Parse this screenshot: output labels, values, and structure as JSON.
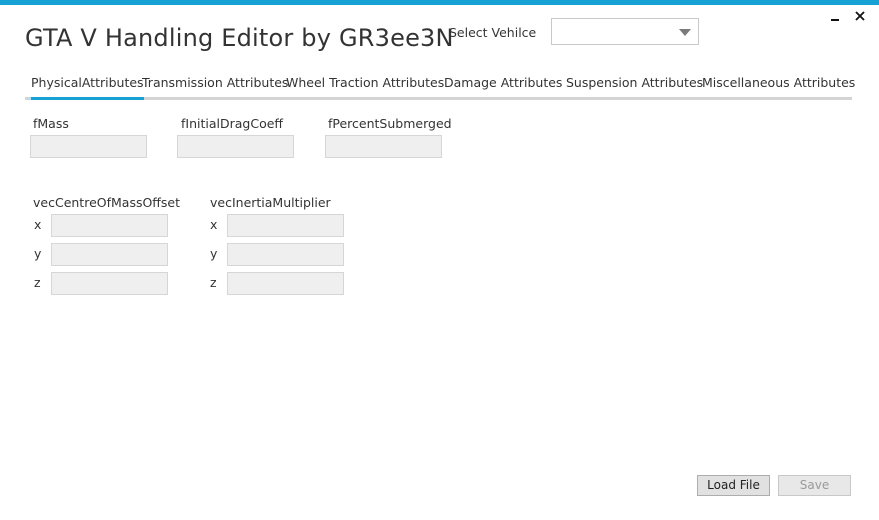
{
  "window": {
    "title": "GTA V Handling Editor by GR3ee3N",
    "minimize_glyph": "▁",
    "close_glyph": "✕"
  },
  "vehicle_select": {
    "label": "Select Vehilce",
    "value": ""
  },
  "tabs": [
    {
      "label": "PhysicalAttributes",
      "active": true
    },
    {
      "label": "Transmission Attributes",
      "active": false
    },
    {
      "label": "Wheel Traction Attributes",
      "active": false
    },
    {
      "label": "Damage Attributes",
      "active": false
    },
    {
      "label": "Suspension Attributes",
      "active": false
    },
    {
      "label": "Miscellaneous Attributes",
      "active": false
    }
  ],
  "fields": {
    "fMass": {
      "label": "fMass",
      "value": ""
    },
    "fInitialDragCoeff": {
      "label": "fInitialDragCoeff",
      "value": ""
    },
    "fPercentSubmerged": {
      "label": "fPercentSubmerged",
      "value": ""
    }
  },
  "vectors": {
    "centre_of_mass": {
      "label": "vecCentreOfMassOffset",
      "axes": [
        {
          "axis": "x",
          "value": ""
        },
        {
          "axis": "y",
          "value": ""
        },
        {
          "axis": "z",
          "value": ""
        }
      ]
    },
    "inertia": {
      "label": "vecInertiaMultiplier",
      "axes": [
        {
          "axis": "x",
          "value": ""
        },
        {
          "axis": "y",
          "value": ""
        },
        {
          "axis": "z",
          "value": ""
        }
      ]
    }
  },
  "buttons": {
    "load_label": "Load File",
    "save_label": "Save"
  },
  "colors": {
    "accent": "#17a2d6",
    "field_bg": "#efefef",
    "tab_rule": "#d4d4d4"
  }
}
